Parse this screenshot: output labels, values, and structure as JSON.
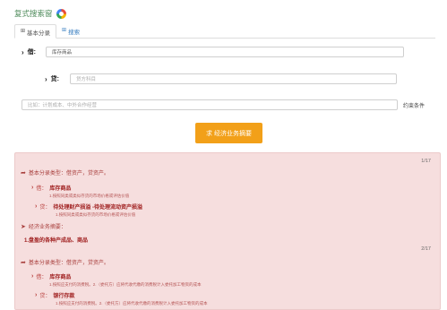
{
  "title": "复式搜索窗",
  "tabs": [
    {
      "label": "基本分录",
      "icon": "grid-icon",
      "active": true
    },
    {
      "label": "搜索",
      "icon": "grid-icon",
      "active": false
    }
  ],
  "form": {
    "debit_label": "借:",
    "debit_value": "库存商品",
    "credit_label": "贷:",
    "credit_placeholder": "贷方科目",
    "constraint_placeholder": "比如：计划成本、中外合作经营",
    "constraint_label": "约束条件",
    "submit_label": "求 经济业务摘要"
  },
  "results": [
    {
      "page": "1/17",
      "type_label": "基本分录类型：借资产，贷资产。",
      "debit_prefix": "借：",
      "debit_account": "库存商品",
      "debit_note": "1.按照同类或类似存货的市场价格或评估价值",
      "credit_prefix": "贷：",
      "credit_account": "待处理财产损溢 -待处理流动资产损溢",
      "credit_note": "1.按照同类或类似存货的市场价格或评估价值",
      "biz_label": "经济业务摘要：",
      "biz_value": "1.盘盈的各种产成品、商品"
    },
    {
      "page": "2/17",
      "type_label": "基本分录类型：借资产，贷资产。",
      "debit_prefix": "借：",
      "debit_account": "库存商品",
      "debit_note": "1.按照应支付的消费税。2.（委托方）应将代收代缴的消费税计入委托加工物资的成本",
      "credit_prefix": "贷：",
      "credit_account": "银行存款",
      "credit_note": "1.按照应支付的消费税。2.（委托方）应将代收代缴的消费税计入委托加工物资的成本"
    }
  ],
  "colors": {
    "accent_button": "#f2a019",
    "result_bg": "#f6dede",
    "result_text": "#a9403e",
    "tab_link": "#3a7fc1"
  }
}
